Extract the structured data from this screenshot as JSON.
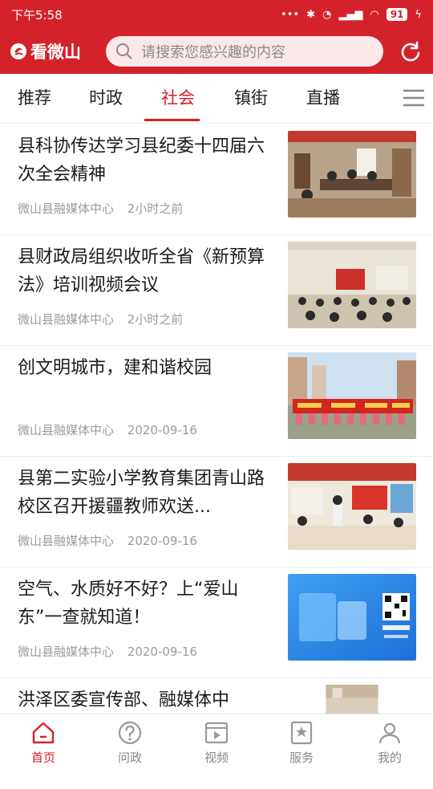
{
  "status_bar": {
    "time": "下午5:58",
    "battery": "91"
  },
  "header": {
    "logo_text": "看微山",
    "search_placeholder": "请搜索您感兴趣的内容"
  },
  "tabs": [
    {
      "label": "推荐"
    },
    {
      "label": "时政"
    },
    {
      "label": "社会",
      "active": true
    },
    {
      "label": "镇街"
    },
    {
      "label": "直播"
    }
  ],
  "news": [
    {
      "title": "县科协传达学习县纪委十四届六次全会精神",
      "source": "微山县融媒体中心",
      "time": "2小时之前",
      "thumb": "meeting-room-photo"
    },
    {
      "title": "县财政局组织收听全省《新预算法》培训视频会议",
      "source": "微山县融媒体中心",
      "time": "2小时之前",
      "thumb": "video-conference-photo"
    },
    {
      "title": "创文明城市，建和谐校园",
      "source": "微山县融媒体中心",
      "time": "2020-09-16",
      "thumb": "banner-outdoor-photo"
    },
    {
      "title": "县第二实验小学教育集团青山路校区召开援疆教师欢送...",
      "source": "微山县融媒体中心",
      "time": "2020-09-16",
      "thumb": "school-meeting-photo"
    },
    {
      "title": "空气、水质好不好？上“爱山东”一查就知道！",
      "source": "微山县融媒体中心",
      "time": "2020-09-16",
      "thumb": "aishandong-app-graphic"
    },
    {
      "title": "洪泽区委宣传部、融媒体中",
      "source": "",
      "time": "",
      "thumb": "partial-photo"
    }
  ],
  "bottom_nav": [
    {
      "label": "首页",
      "icon": "home-icon",
      "active": true
    },
    {
      "label": "问政",
      "icon": "question-icon"
    },
    {
      "label": "视频",
      "icon": "video-icon"
    },
    {
      "label": "服务",
      "icon": "service-icon"
    },
    {
      "label": "我的",
      "icon": "user-icon"
    }
  ],
  "colors": {
    "brand_red": "#d4222a",
    "text": "#1b1b1b",
    "meta_gray": "#9a9a9a"
  }
}
